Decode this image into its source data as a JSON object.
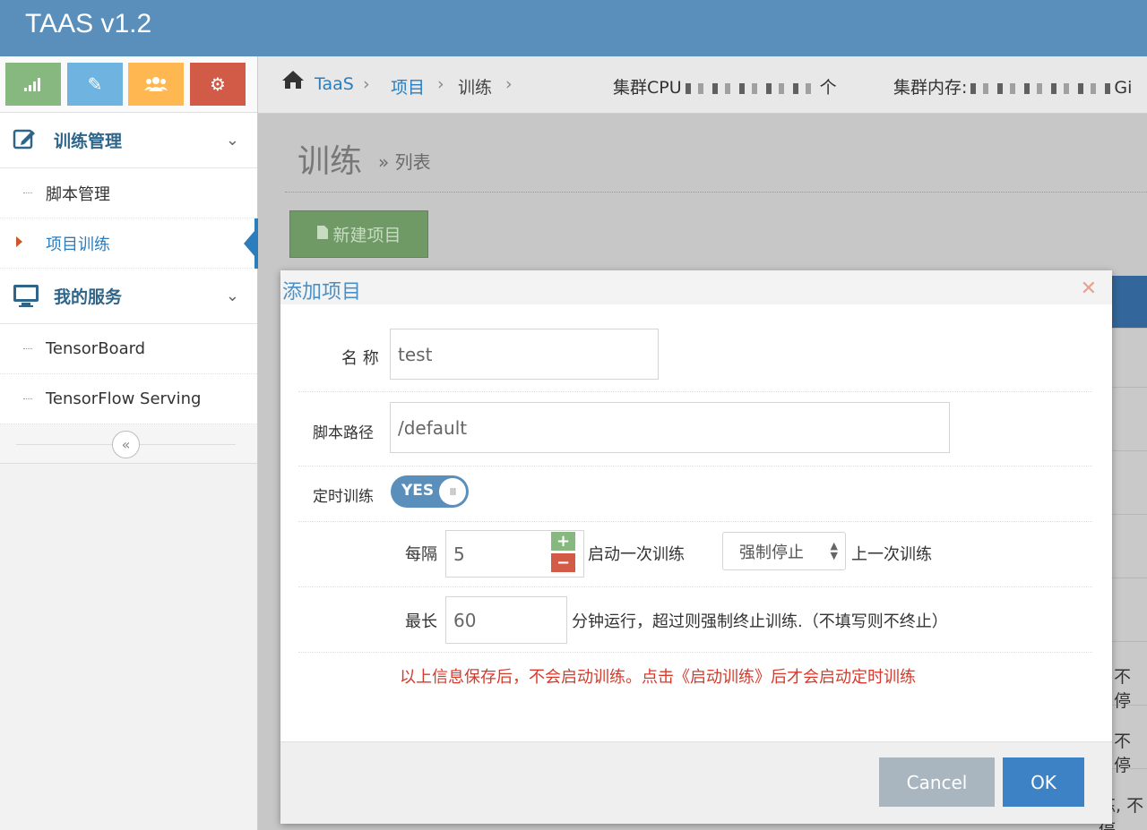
{
  "app": {
    "brand": "TAAS v1.2"
  },
  "sidebar": {
    "shortcuts": [
      {
        "icon": "signal-bars-icon"
      },
      {
        "icon": "pencil-icon"
      },
      {
        "icon": "users-icon"
      },
      {
        "icon": "gears-icon"
      }
    ],
    "sections": [
      {
        "label": "训练管理",
        "icon": "edit-icon",
        "items": [
          "脚本管理",
          "项目训练"
        ]
      },
      {
        "label": "我的服务",
        "icon": "monitor-icon",
        "items": [
          "TensorBoard",
          "TensorFlow Serving"
        ]
      }
    ]
  },
  "breadcrumb": {
    "home": "TaaS",
    "level1": "项目",
    "level2": "训练",
    "cpu_label": "集群CPU",
    "cpu_suffix": "个",
    "mem_label": "集群内存:",
    "mem_suffix": "Gi"
  },
  "page": {
    "title": "训练",
    "subtitle": "» 列表",
    "new_button": "新建项目"
  },
  "table_fragments": [
    "不停",
    "不停",
    "练, 不停"
  ],
  "modal": {
    "title": "添加项目",
    "name_label": "名 称",
    "name_value": "test",
    "script_label": "脚本路径",
    "script_value": "/default",
    "schedule_label": "定时训练",
    "toggle_text": "YES",
    "toggle_knob": "III",
    "every_label": "每隔",
    "every_value": "5",
    "start_text": "启动一次训练",
    "select_value": "强制停止",
    "last_text": "上一次训练",
    "max_label": "最长",
    "max_value": "60",
    "max_text": "分钟运行，超过则强制终止训练.（不填写则不终止）",
    "warning": "以上信息保存后，不会启动训练。点击《启动训练》后才会启动定时训练",
    "cancel": "Cancel",
    "ok": "OK"
  },
  "colors": {
    "navbar": "#5a8fbc",
    "accent": "#2b7dbc",
    "warn": "#d9382b",
    "ok": "#3d82c4"
  }
}
